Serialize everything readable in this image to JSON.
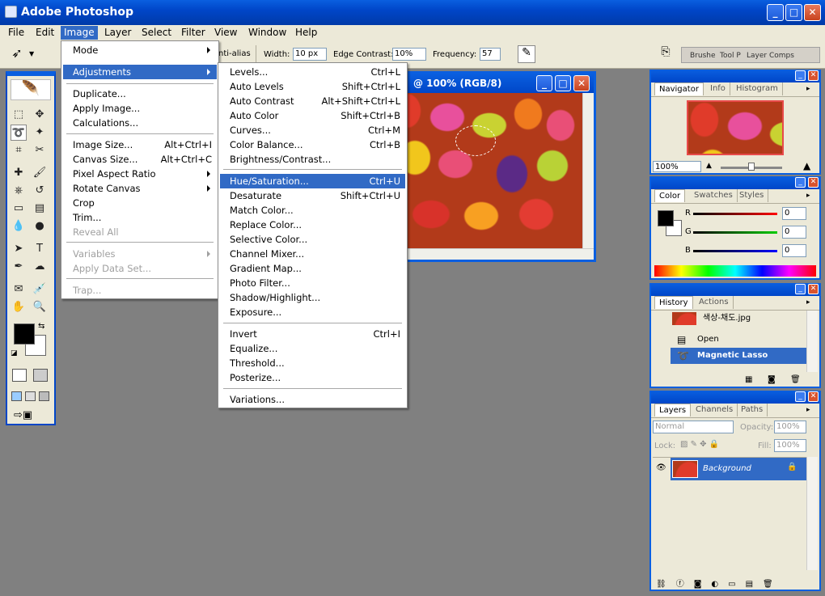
{
  "app": {
    "title": "Adobe Photoshop"
  },
  "window_controls": {
    "minimize": "_",
    "maximize": "□",
    "close": "✕"
  },
  "menubar": [
    "File",
    "Edit",
    "Image",
    "Layer",
    "Select",
    "Filter",
    "View",
    "Window",
    "Help"
  ],
  "options": {
    "antialias": "nti-alias",
    "width_label": "Width:",
    "width_value": "10 px",
    "edge_label": "Edge Contrast:",
    "edge_value": "10%",
    "freq_label": "Frequency:",
    "freq_value": "57",
    "well_tabs": [
      "Brushe",
      "Tool P",
      "Layer Comps"
    ]
  },
  "image_menu": [
    {
      "label": "Mode",
      "submenu": true
    },
    {
      "label": "Adjustments",
      "submenu": true,
      "highlight": true
    },
    {
      "label": "Duplicate..."
    },
    {
      "label": "Apply Image..."
    },
    {
      "label": "Calculations..."
    },
    {
      "label": "Image Size...",
      "shortcut": "Alt+Ctrl+I"
    },
    {
      "label": "Canvas Size...",
      "shortcut": "Alt+Ctrl+C"
    },
    {
      "label": "Pixel Aspect Ratio",
      "submenu": true
    },
    {
      "label": "Rotate Canvas",
      "submenu": true
    },
    {
      "label": "Crop"
    },
    {
      "label": "Trim..."
    },
    {
      "label": "Reveal All",
      "disabled": true
    },
    {
      "label": "Variables",
      "submenu": true,
      "disabled": true
    },
    {
      "label": "Apply Data Set...",
      "disabled": true
    },
    {
      "label": "Trap...",
      "disabled": true
    }
  ],
  "adjust_menu": [
    {
      "label": "Levels...",
      "shortcut": "Ctrl+L"
    },
    {
      "label": "Auto Levels",
      "shortcut": "Shift+Ctrl+L"
    },
    {
      "label": "Auto Contrast",
      "shortcut": "Alt+Shift+Ctrl+L"
    },
    {
      "label": "Auto Color",
      "shortcut": "Shift+Ctrl+B"
    },
    {
      "label": "Curves...",
      "shortcut": "Ctrl+M"
    },
    {
      "label": "Color Balance...",
      "shortcut": "Ctrl+B"
    },
    {
      "label": "Brightness/Contrast..."
    },
    {
      "label": "Hue/Saturation...",
      "shortcut": "Ctrl+U",
      "highlight": true
    },
    {
      "label": "Desaturate",
      "shortcut": "Shift+Ctrl+U"
    },
    {
      "label": "Match Color..."
    },
    {
      "label": "Replace Color..."
    },
    {
      "label": "Selective Color..."
    },
    {
      "label": "Channel Mixer..."
    },
    {
      "label": "Gradient Map..."
    },
    {
      "label": "Photo Filter..."
    },
    {
      "label": "Shadow/Highlight..."
    },
    {
      "label": "Exposure..."
    },
    {
      "label": "Invert",
      "shortcut": "Ctrl+I"
    },
    {
      "label": "Equalize..."
    },
    {
      "label": "Threshold..."
    },
    {
      "label": "Posterize..."
    },
    {
      "label": "Variations..."
    }
  ],
  "document": {
    "title": "@ 100% (RGB/8)"
  },
  "navigator": {
    "tabs": [
      "Navigator",
      "Info",
      "Histogram"
    ],
    "zoom": "100%"
  },
  "color": {
    "tabs": [
      "Color",
      "Swatches",
      "Styles"
    ],
    "channels": [
      {
        "name": "R",
        "value": "0"
      },
      {
        "name": "G",
        "value": "0"
      },
      {
        "name": "B",
        "value": "0"
      }
    ]
  },
  "history": {
    "tabs": [
      "History",
      "Actions"
    ],
    "snapshot": "색상-채도.jpg",
    "steps": [
      "Open",
      "Magnetic Lasso"
    ]
  },
  "layers": {
    "tabs": [
      "Layers",
      "Channels",
      "Paths"
    ],
    "mode": "Normal",
    "opacity_label": "Opacity:",
    "opacity": "100%",
    "lock_label": "Lock:",
    "fill_label": "Fill:",
    "fill": "100%",
    "layer_name": "Background"
  },
  "colors": {
    "accent": "#316ac5",
    "titlebar": "#0a5fe0"
  }
}
